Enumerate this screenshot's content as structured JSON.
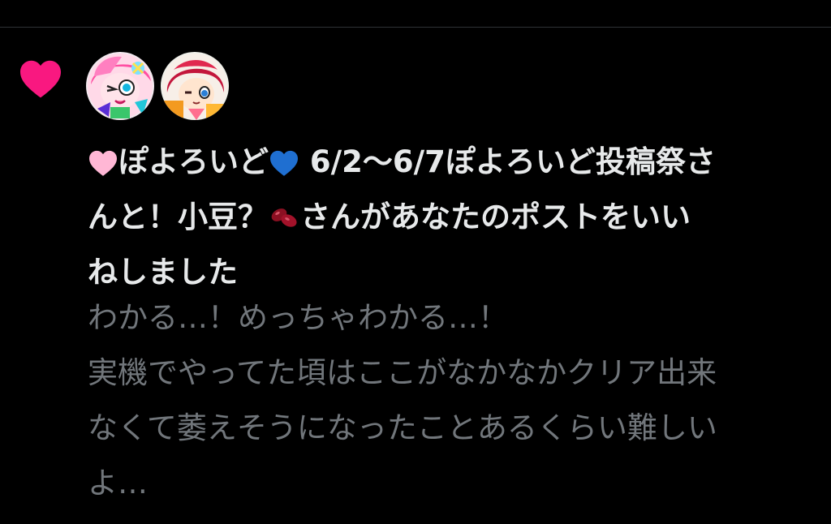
{
  "notification": {
    "icon": "heart-icon",
    "icon_color": "#f91880",
    "avatars": [
      {
        "name": "avatar-pink-character"
      },
      {
        "name": "avatar-red-hair-character"
      }
    ],
    "user1_prefix": "ぽよろいど",
    "user1_suffix": " 6/2〜6/7ぽよろいど投稿祭さ",
    "line2_a": "んと！小豆？",
    "line2_b": "さんがあなたのポストをいい",
    "line3": "ねしました",
    "quote_lines": [
      "わかる…！めっちゃわかる…！",
      "実機でやってた頃はここがなかなかクリア出来",
      "なくて萎えそうになったことあるくらい難しい",
      "よ…"
    ]
  },
  "colors": {
    "background": "#000000",
    "primary_text": "#e7e9ea",
    "secondary_text": "#71767b",
    "divider": "#2f3336"
  }
}
